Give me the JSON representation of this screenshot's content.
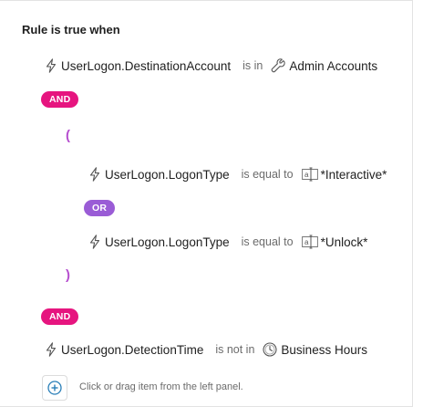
{
  "rule": {
    "title": "Rule is true when",
    "condition1": {
      "field": "UserLogon.DestinationAccount",
      "operator": "is in",
      "value": "Admin Accounts",
      "field_icon": "lightning-icon",
      "value_icon": "wrench-icon"
    },
    "and1": "AND",
    "open_paren": "(",
    "condition2": {
      "field": "UserLogon.LogonType",
      "operator": "is equal to",
      "value": "*Interactive*",
      "field_icon": "lightning-icon",
      "value_icon": "text-value-icon"
    },
    "or1": "OR",
    "condition3": {
      "field": "UserLogon.LogonType",
      "operator": "is equal to",
      "value": "*Unlock*",
      "field_icon": "lightning-icon",
      "value_icon": "text-value-icon"
    },
    "close_paren": ")",
    "and2": "AND",
    "condition4": {
      "field": "UserLogon.DetectionTime",
      "operator": "is not in",
      "value": "Business Hours",
      "field_icon": "lightning-icon",
      "value_icon": "clock-icon"
    },
    "add_hint": "Click or drag item from the left panel."
  },
  "colors": {
    "and_badge": "#e6157f",
    "or_badge": "#9a5cd6",
    "paren": "#b64fcf",
    "add_icon": "#2a7fb8"
  }
}
